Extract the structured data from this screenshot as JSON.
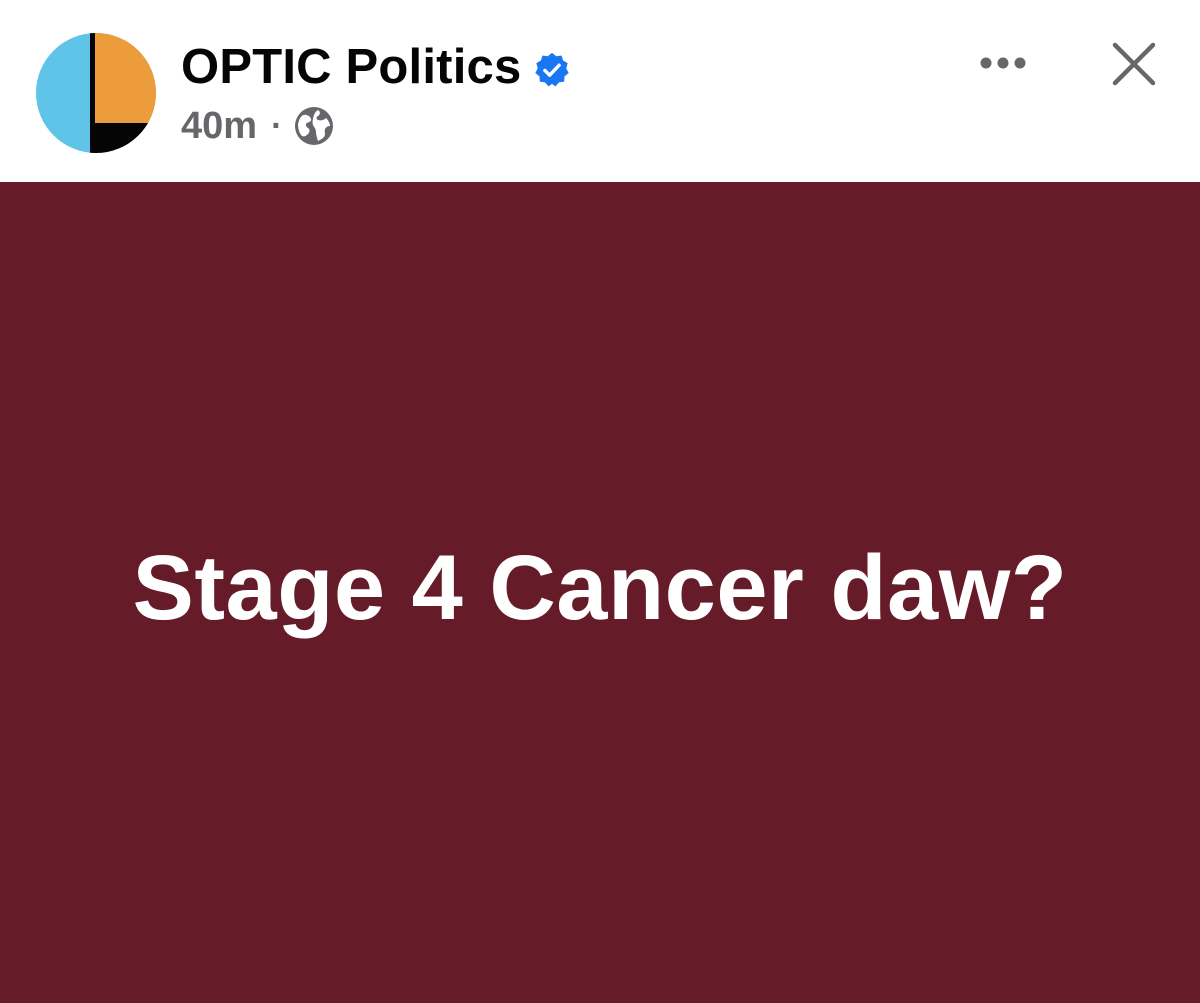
{
  "post": {
    "page_name": "OPTIC Politics",
    "verified": true,
    "time_ago": "40m",
    "separator": "·",
    "privacy_icon": "globe-icon",
    "content_text": "Stage 4 Cancer daw?",
    "background_color": "#661b28",
    "text_color": "#ffffff"
  },
  "header": {
    "more_icon": "more-horizontal-icon",
    "close_icon": "close-icon"
  },
  "avatar": {
    "colors": [
      "#5fc4e8",
      "#ec9c3a",
      "#050505"
    ]
  },
  "colors": {
    "verified_badge": "#1877f2",
    "secondary_text": "#65676b",
    "primary_text": "#050505"
  }
}
